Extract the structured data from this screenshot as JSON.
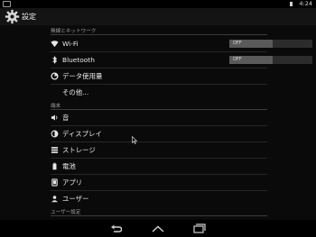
{
  "status_bar": {
    "time": "4:24"
  },
  "action_bar": {
    "title": "設定",
    "icon": "gear-icon"
  },
  "sections": {
    "wireless": "無線とネットワーク",
    "device": "端末",
    "user": "ユーザー設定"
  },
  "items": {
    "wifi": {
      "label": "Wi-Fi",
      "icon": "wifi-icon",
      "toggle": "OFF"
    },
    "bluetooth": {
      "label": "Bluetooth",
      "icon": "bluetooth-icon",
      "toggle": "OFF"
    },
    "data_usage": {
      "label": "データ使用量",
      "icon": "data-usage-icon"
    },
    "more": {
      "label": "その他..."
    },
    "sound": {
      "label": "音",
      "icon": "speaker-icon"
    },
    "display": {
      "label": "ディスプレイ",
      "icon": "brightness-icon"
    },
    "storage": {
      "label": "ストレージ",
      "icon": "storage-icon"
    },
    "battery": {
      "label": "電池",
      "icon": "battery-icon"
    },
    "apps": {
      "label": "アプリ",
      "icon": "apps-icon"
    },
    "users": {
      "label": "ユーザー",
      "icon": "user-icon"
    }
  },
  "nav_bar": {
    "buttons": [
      "back-icon",
      "home-icon",
      "recents-icon"
    ]
  },
  "colors": {
    "background": "#0a0a0a",
    "toggle_off": "#5a5a5a",
    "text": "#eaeaea",
    "section_text": "#9e9e9e"
  }
}
